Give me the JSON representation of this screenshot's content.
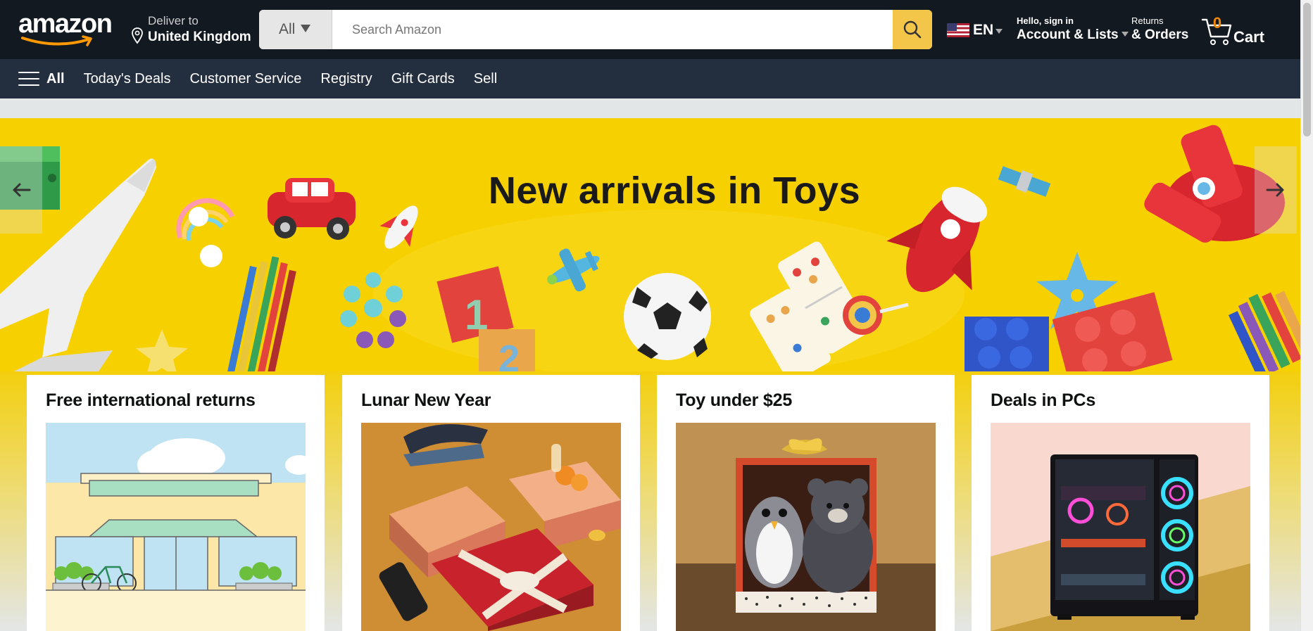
{
  "header": {
    "logo_text": "amazon",
    "deliver": {
      "line1": "Deliver to",
      "line2": "United Kingdom"
    },
    "search": {
      "category": "All",
      "placeholder": "Search Amazon"
    },
    "language": {
      "code": "EN"
    },
    "account": {
      "line1": "Hello, sign in",
      "line2": "Account & Lists"
    },
    "orders": {
      "line1": "Returns",
      "line2": "& Orders"
    },
    "cart": {
      "count": "0",
      "label": "Cart"
    }
  },
  "nav": {
    "all_label": "All",
    "items": [
      "Today's Deals",
      "Customer Service",
      "Registry",
      "Gift Cards",
      "Sell"
    ]
  },
  "hero": {
    "title": "New arrivals in Toys"
  },
  "cards": [
    {
      "title": "Free international returns"
    },
    {
      "title": "Lunar New Year"
    },
    {
      "title": "Toy under $25"
    },
    {
      "title": "Deals in PCs"
    }
  ],
  "colors": {
    "header_bg": "#131921",
    "nav_bg": "#232f3e",
    "search_button": "#f3c64a",
    "cart_count": "#f08804",
    "hero_bg": "#f7d000"
  }
}
